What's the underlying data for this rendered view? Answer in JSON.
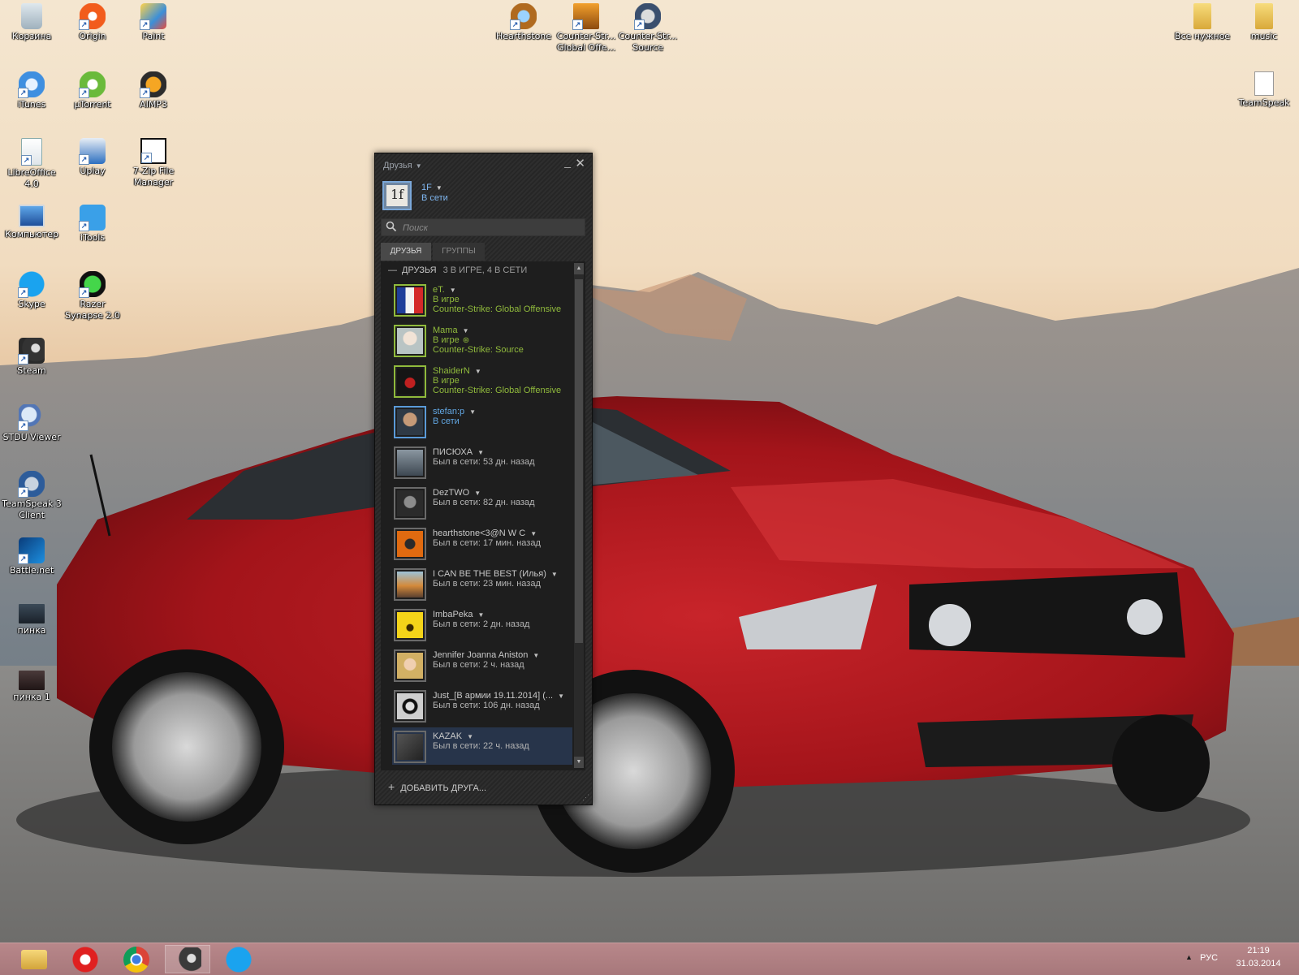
{
  "desktop_icons": [
    {
      "label": "Корзина",
      "icon": "recycle-bin-icon"
    },
    {
      "label": "Origin",
      "icon": "origin-icon"
    },
    {
      "label": "Paint",
      "icon": "paint-icon"
    },
    {
      "label": "iTunes",
      "icon": "itunes-icon"
    },
    {
      "label": "µTorrent",
      "icon": "utorrent-icon"
    },
    {
      "label": "AIMP3",
      "icon": "aimp-icon"
    },
    {
      "label": "LibreOffice 4.0",
      "icon": "libreoffice-icon"
    },
    {
      "label": "Uplay",
      "icon": "uplay-icon"
    },
    {
      "label": "7-Zip File Manager",
      "icon": "7zip-icon"
    },
    {
      "label": "Компьютер",
      "icon": "computer-icon"
    },
    {
      "label": "iTools",
      "icon": "itools-icon"
    },
    {
      "label": "Skype",
      "icon": "skype-icon"
    },
    {
      "label": "Razer Synapse 2.0",
      "icon": "razer-icon"
    },
    {
      "label": "Steam",
      "icon": "steam-icon"
    },
    {
      "label": "STDU Viewer",
      "icon": "stdu-viewer-icon"
    },
    {
      "label": "TeamSpeak 3 Client",
      "icon": "teamspeak-icon"
    },
    {
      "label": "Battle.net",
      "icon": "battlenet-icon"
    },
    {
      "label": "пинка",
      "icon": "video-file-icon"
    },
    {
      "label": "пинка 1",
      "icon": "video-file-icon"
    },
    {
      "label": "Hearthstone",
      "icon": "hearthstone-icon"
    },
    {
      "label": "Counter-Str... Global Offe...",
      "icon": "csgo-icon"
    },
    {
      "label": "Counter-Str... Source",
      "icon": "css-icon"
    },
    {
      "label": "Все нужное",
      "icon": "folder-icon"
    },
    {
      "label": "music",
      "icon": "folder-icon"
    },
    {
      "label": "TeamSpeak",
      "icon": "text-file-icon"
    }
  ],
  "steam": {
    "title": "Друзья",
    "me": {
      "avatar_text": "1f",
      "name": "1F",
      "status": "В сети"
    },
    "search_placeholder": "Поиск",
    "tabs": [
      "ДРУЗЬЯ",
      "ГРУППЫ"
    ],
    "group": {
      "name": "ДРУЗЬЯ",
      "counts": "3 В ИГРЕ, 4 В СЕТИ"
    },
    "friends": [
      {
        "name": "eT.",
        "status": "В игре",
        "game": "Counter-Strike: Global Offensive",
        "state": "ingame"
      },
      {
        "name": "Mama",
        "status": "В игре",
        "game": "Counter-Strike: Source",
        "state": "ingame"
      },
      {
        "name": "ShaiderN",
        "status": "В игре",
        "game": "Counter-Strike: Global Offensive",
        "state": "ingame"
      },
      {
        "name": "stefan:p",
        "status": "В сети",
        "game": "",
        "state": "online"
      },
      {
        "name": "ПИСЮХА",
        "status": "Был в сети: 53 дн. назад",
        "game": "",
        "state": "offline"
      },
      {
        "name": "DezTWO",
        "status": "Был в сети: 82 дн. назад",
        "game": "",
        "state": "offline"
      },
      {
        "name": "hearthstone<3@N W C",
        "status": "Был в сети: 17 мин. назад",
        "game": "",
        "state": "offline"
      },
      {
        "name": "I CAN BE THE BEST (Илья)",
        "status": "Был в сети: 23 мин. назад",
        "game": "",
        "state": "offline"
      },
      {
        "name": "ImbaPeka",
        "status": "Был в сети: 2 дн. назад",
        "game": "",
        "state": "offline"
      },
      {
        "name": "Jennifer Joanna Aniston",
        "status": "Был в сети: 2 ч. назад",
        "game": "",
        "state": "offline"
      },
      {
        "name": "Just_[В армии 19.11.2014] (...",
        "status": "Был в сети: 106 дн. назад",
        "game": "",
        "state": "offline"
      },
      {
        "name": "KAZAK",
        "status": "Был в сети: 22 ч. назад",
        "game": "",
        "state": "offline"
      }
    ],
    "add_friend": "ДОБАВИТЬ ДРУГА..."
  },
  "taskbar": {
    "apps": [
      "file-explorer-icon",
      "yandex-browser-icon",
      "chrome-icon",
      "steam-icon",
      "skype-icon"
    ],
    "lang": "РУС",
    "time": "21:19",
    "date": "31.03.2014"
  }
}
